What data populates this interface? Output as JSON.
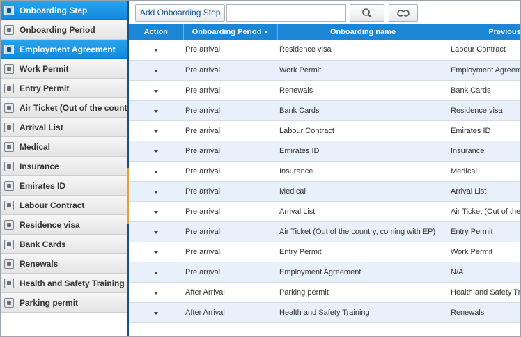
{
  "sidebar": {
    "items": [
      {
        "label": "Onboarding Step",
        "icon": "user-gear-icon",
        "active": true
      },
      {
        "label": "Onboarding Period",
        "icon": "id-card-icon",
        "active": false
      },
      {
        "label": "Employment Agreement",
        "icon": "user-contract-icon",
        "active": true
      },
      {
        "label": "Work Permit",
        "icon": "document-icon",
        "active": false
      },
      {
        "label": "Entry Permit",
        "icon": "card-icon",
        "active": false
      },
      {
        "label": "Air Ticket (Out of the country, coming with EP)",
        "icon": "ticket-icon",
        "active": false
      },
      {
        "label": "Arrival List",
        "icon": "arrival-icon",
        "active": false
      },
      {
        "label": "Medical",
        "icon": "medical-icon",
        "active": false
      },
      {
        "label": "Insurance",
        "icon": "insurance-icon",
        "active": false
      },
      {
        "label": "Emirates ID",
        "icon": "id-icon",
        "active": false
      },
      {
        "label": "Labour Contract",
        "icon": "contract-icon",
        "active": false
      },
      {
        "label": "Residence visa",
        "icon": "visa-icon",
        "active": false
      },
      {
        "label": "Bank Cards",
        "icon": "bank-card-icon",
        "active": false
      },
      {
        "label": "Renewals",
        "icon": "renewal-icon",
        "active": false
      },
      {
        "label": "Health and Safety Training",
        "icon": "safety-icon",
        "active": false
      },
      {
        "label": "Parking permit",
        "icon": "parking-icon",
        "active": false
      }
    ]
  },
  "toolbar": {
    "add_label": "Add Onboarding Step",
    "search_value": "",
    "search_icon": "magnifier-icon",
    "reset_icon": "link-reset-icon"
  },
  "table": {
    "headers": {
      "action": "Action",
      "period": "Onboarding Period",
      "name": "Onboarding name",
      "prev": "Previous"
    },
    "rows": [
      {
        "period": "Pre arrival",
        "name": "Residence visa",
        "prev": "Labour Contract"
      },
      {
        "period": "Pre arrival",
        "name": "Work Permit",
        "prev": "Employment Agreement"
      },
      {
        "period": "Pre arrival",
        "name": "Renewals",
        "prev": "Bank Cards"
      },
      {
        "period": "Pre arrival",
        "name": "Bank Cards",
        "prev": "Residence visa"
      },
      {
        "period": "Pre arrival",
        "name": "Labour Contract",
        "prev": "Emirates ID"
      },
      {
        "period": "Pre arrival",
        "name": "Emirates ID",
        "prev": "Insurance"
      },
      {
        "period": "Pre arrival",
        "name": "Insurance",
        "prev": "Medical"
      },
      {
        "period": "Pre arrival",
        "name": "Medical",
        "prev": "Arrival List"
      },
      {
        "period": "Pre arrival",
        "name": "Arrival List",
        "prev": "Air Ticket (Out of the country, coming with EP)"
      },
      {
        "period": "Pre arrival",
        "name": "Air Ticket (Out of the country, coming with EP)",
        "prev": "Entry Permit"
      },
      {
        "period": "Pre arrival",
        "name": "Entry Permit",
        "prev": "Work Permit"
      },
      {
        "period": "Pre arrival",
        "name": "Employment Agreement",
        "prev": "N/A"
      },
      {
        "period": "After Arrival",
        "name": "Parking permit",
        "prev": "Health and Safety Training"
      },
      {
        "period": "After Arrival",
        "name": "Health and Safety Training",
        "prev": "Renewals"
      }
    ]
  },
  "colors": {
    "accent": "#1b85d6",
    "sidebar_active": "#1289dd",
    "row_alt": "#e8f1fb",
    "splitter": "#1a4f80",
    "grip": "#e0a238"
  }
}
